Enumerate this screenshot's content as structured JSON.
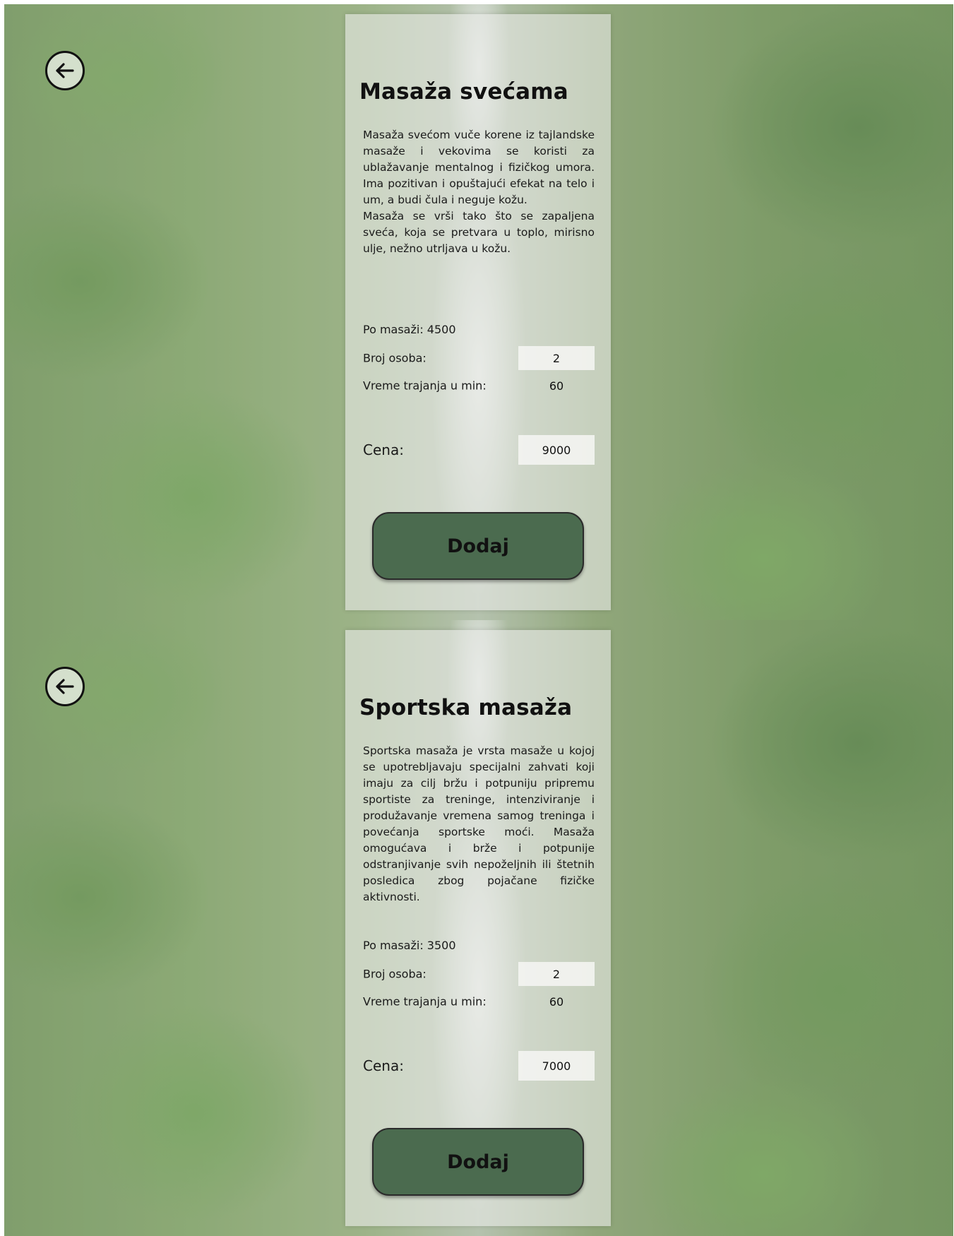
{
  "icons": {
    "back": "arrow-left-circle-icon"
  },
  "colors": {
    "button_bg": "#4b6b4f",
    "card_bg": "#e8eae6"
  },
  "screens": [
    {
      "title": "Masaža svećama",
      "description": "Masaža svećom vuče korene iz tajlandske masaže i vekovima se koristi za ublažavanje mentalnog i fizičkog umora. Ima pozitivan i opuštajući efekat na telo i um, a budi čula i neguje kožu.\nMasaža se vrši tako što se zapaljena sveća, koja se pretvara u toplo, mirisno ulje, nežno utrljava u kožu.",
      "per_massage_label": "Po masaži: 4500",
      "persons_label": "Broj osoba:",
      "persons_value": "2",
      "duration_label": "Vreme trajanja u min:",
      "duration_value": "60",
      "price_label": "Cena:",
      "price_value": "9000",
      "add_label": "Dodaj"
    },
    {
      "title": "Sportska masaža",
      "description": "Sportska masaža je vrsta masaže u kojoj se upotrebljavaju specijalni zahvati koji imaju za cilj bržu i potpuniju pripremu sportiste za treninge, intenziviranje i produžavanje vremena samog treninga i povećanja sportske moći. Masaža omogućava i brže i potpunije odstranjivanje svih nepoželjnih ili štetnih posledica zbog pojačane fizičke aktivnosti.",
      "per_massage_label": "Po masaži: 3500",
      "persons_label": "Broj osoba:",
      "persons_value": "2",
      "duration_label": "Vreme trajanja u min:",
      "duration_value": "60",
      "price_label": "Cena:",
      "price_value": "7000",
      "add_label": "Dodaj"
    }
  ]
}
